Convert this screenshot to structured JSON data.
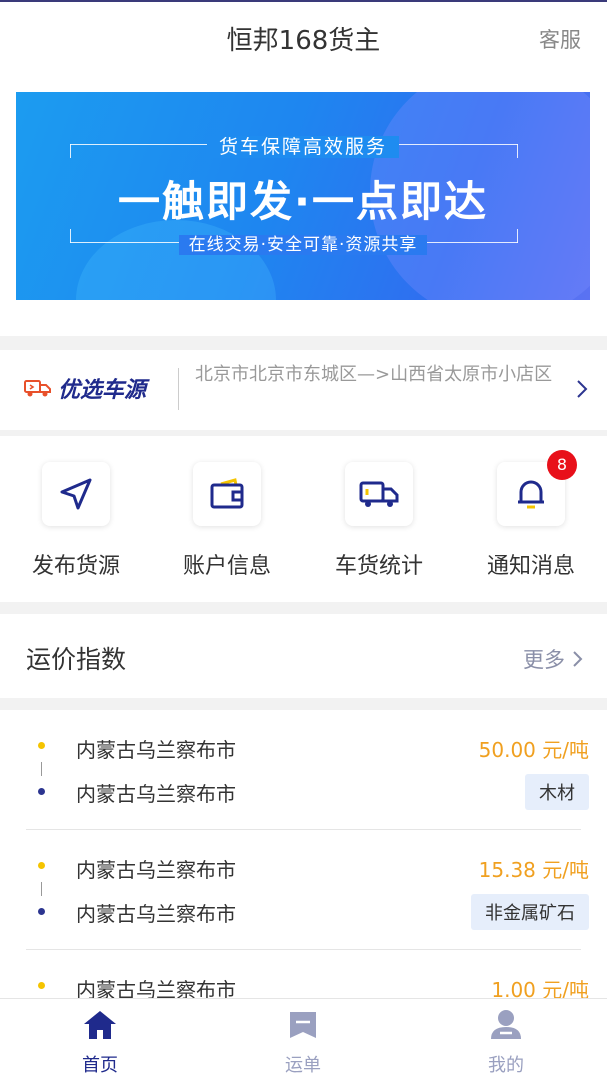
{
  "header": {
    "title": "恒邦168货主",
    "service_label": "客服"
  },
  "banner": {
    "subtitle": "货车保障高效服务",
    "headline": "一触即发·一点即达",
    "tagline": "在线交易·安全可靠·资源共享"
  },
  "notice": {
    "logo_text": "优选车源",
    "route": "北京市北京市东城区—>山西省太原市小店区"
  },
  "quick_menu": [
    {
      "label": "发布货源",
      "icon": "send-icon"
    },
    {
      "label": "账户信息",
      "icon": "wallet-icon"
    },
    {
      "label": "车货统计",
      "icon": "truck-icon"
    },
    {
      "label": "通知消息",
      "icon": "bell-icon",
      "badge": "8"
    }
  ],
  "freight_index": {
    "title": "运价指数",
    "more_label": "更多",
    "items": [
      {
        "from": "内蒙古乌兰察布市",
        "to": "内蒙古乌兰察布市",
        "price": "50.00 元/吨",
        "cargo": "木材"
      },
      {
        "from": "内蒙古乌兰察布市",
        "to": "内蒙古乌兰察布市",
        "price": "15.38 元/吨",
        "cargo": "非金属矿石"
      },
      {
        "from": "内蒙古乌兰察布市",
        "to": "",
        "price": "1.00 元/吨",
        "cargo": ""
      }
    ]
  },
  "tabbar": [
    {
      "label": "首页",
      "icon": "home-icon",
      "active": true
    },
    {
      "label": "运单",
      "icon": "waybill-icon",
      "active": false
    },
    {
      "label": "我的",
      "icon": "profile-icon",
      "active": false
    }
  ],
  "colors": {
    "brand": "#1f2a8c",
    "price": "#f0a020",
    "badge": "#e8101a",
    "inactive": "#9aa0c0"
  }
}
